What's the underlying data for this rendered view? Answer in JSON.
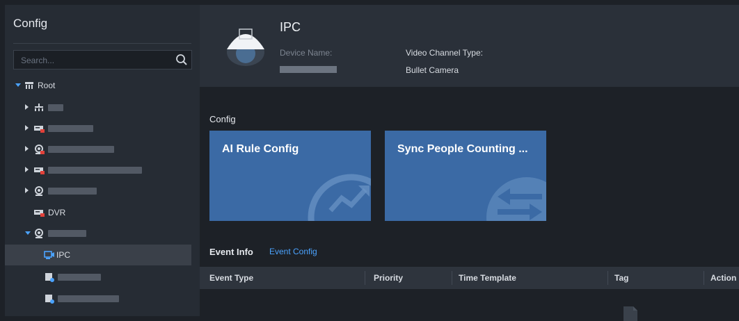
{
  "sidebar": {
    "title": "Config",
    "search": {
      "placeholder": "Search...",
      "value": ""
    },
    "tree": {
      "root_label": "Root",
      "dvr_label": "DVR",
      "ipc_label": "IPC"
    }
  },
  "device": {
    "title": "IPC",
    "device_name_label": "Device Name:",
    "video_channel_type_label": "Video Channel Type:",
    "video_channel_type_value": "Bullet Camera"
  },
  "config_section": {
    "title": "Config",
    "cards": [
      {
        "label": "AI Rule Config",
        "icon": "trend-chart-icon"
      },
      {
        "label": "Sync People Counting ...",
        "icon": "sync-arrows-icon"
      }
    ]
  },
  "event_info": {
    "title": "Event Info",
    "config_link": "Event Config",
    "columns": [
      "Event Type",
      "Priority",
      "Time Template",
      "Tag",
      "Action"
    ]
  },
  "colors": {
    "accent": "#4ba3ff",
    "card": "#3b6aa5",
    "sidebar_bg": "#262c34",
    "header_bg": "#2a3039"
  }
}
